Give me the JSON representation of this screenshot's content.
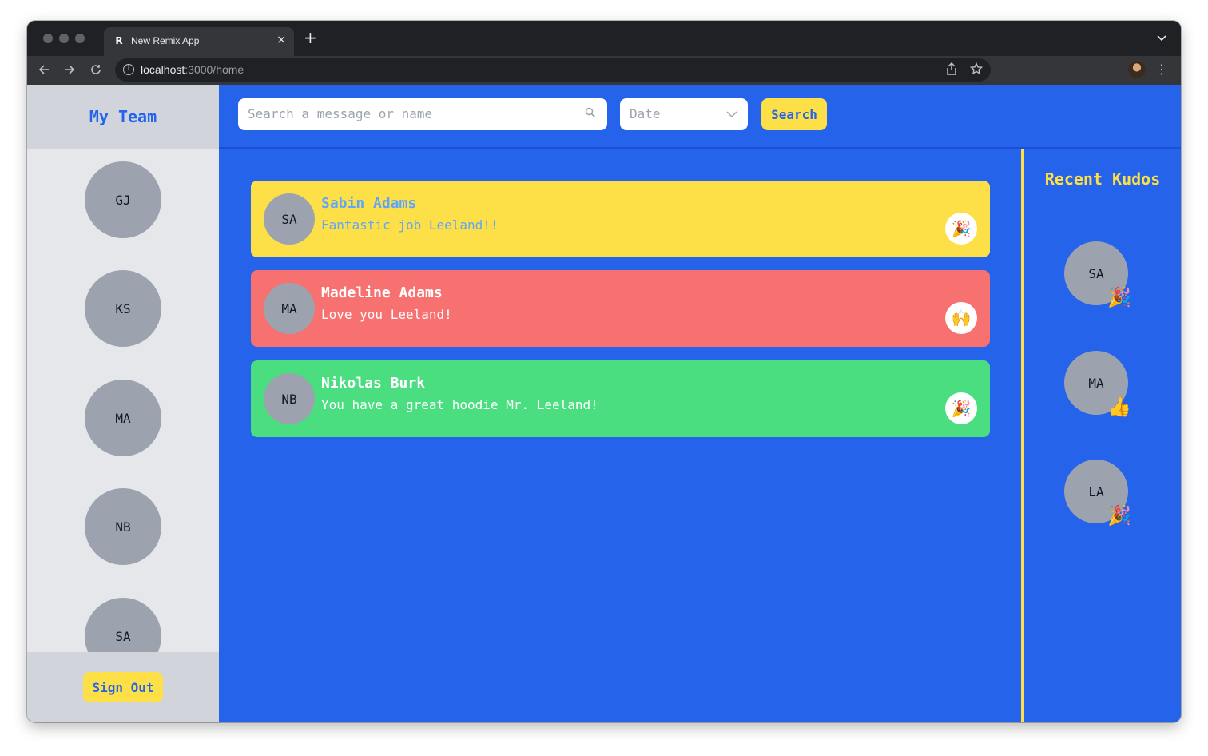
{
  "browser": {
    "tab_title": "New Remix App",
    "tab_close": "×",
    "new_tab": "+",
    "favicon": "R",
    "url_host": "localhost",
    "url_rest": ":3000/home",
    "icons": [
      "back-icon",
      "forward-icon",
      "reload-icon",
      "info-icon",
      "share-icon",
      "star-icon",
      "profile-avatar",
      "more-icon",
      "tab-list-chevron-icon"
    ]
  },
  "sidebar": {
    "title": "My Team",
    "members": [
      "GJ",
      "KS",
      "MA",
      "NB",
      "SA"
    ],
    "sign_out": "Sign Out"
  },
  "topbar": {
    "search_placeholder": "Search a message or name",
    "date_placeholder": "Date",
    "search_button": "Search"
  },
  "feed": {
    "kudos": [
      {
        "initials": "SA",
        "name": "Sabin Adams",
        "message": "Fantastic job Leeland!!",
        "emoji": "🎉",
        "bg": "#fde047",
        "text": "#60a5fa"
      },
      {
        "initials": "MA",
        "name": "Madeline Adams",
        "message": "Love you Leeland!",
        "emoji": "🙌",
        "bg": "#f87171",
        "text": "#ffffff"
      },
      {
        "initials": "NB",
        "name": "Nikolas Burk",
        "message": "You have a great hoodie Mr. Leeland!",
        "emoji": "🎉",
        "bg": "#4ade80",
        "text": "#ffffff"
      }
    ]
  },
  "recent": {
    "title": "Recent Kudos",
    "items": [
      {
        "initials": "SA",
        "emoji": "🎉"
      },
      {
        "initials": "MA",
        "emoji": "👍"
      },
      {
        "initials": "LA",
        "emoji": "🎉"
      }
    ]
  },
  "colors": {
    "primary_blue": "#2563eb",
    "accent_yellow": "#fde047",
    "sidebar_gray": "#e5e7eb",
    "avatar_gray": "#9ca3af"
  }
}
